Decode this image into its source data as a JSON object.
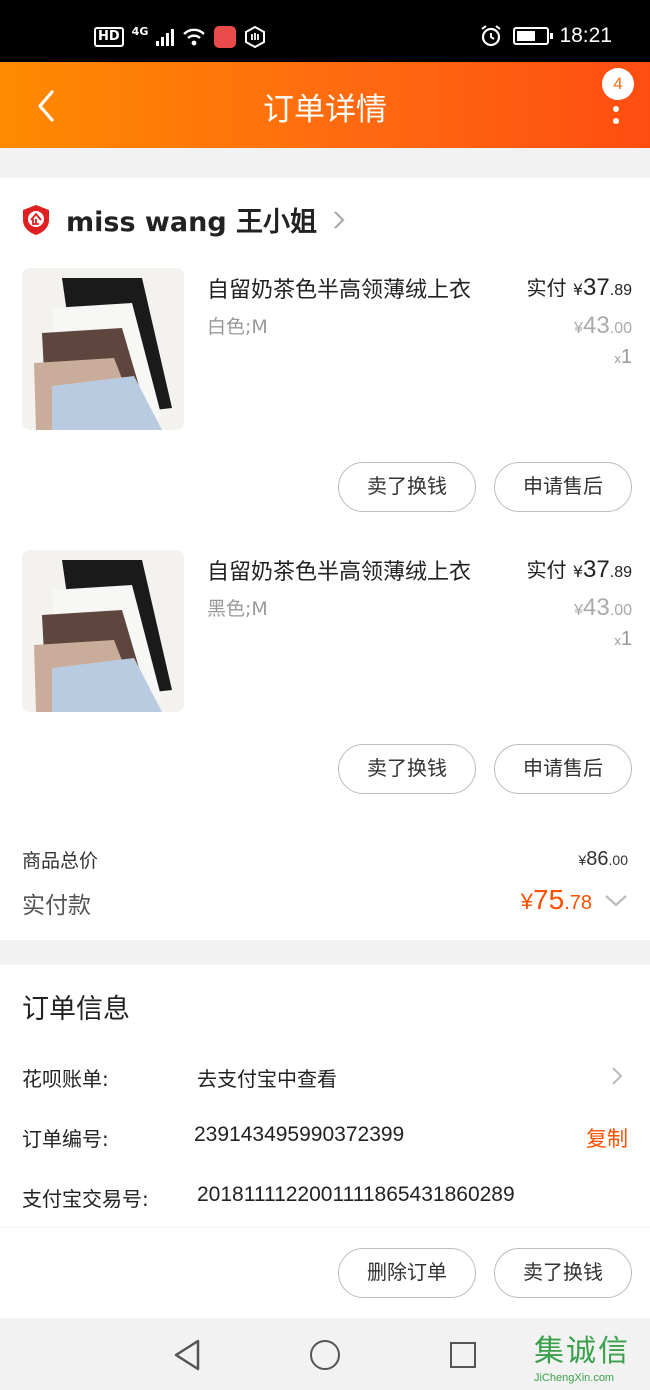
{
  "status_bar": {
    "hd": "HD",
    "network": "4G",
    "time": "18:21"
  },
  "header": {
    "title": "订单详情",
    "badge_count": "4"
  },
  "shop": {
    "name": "miss wang 王小姐"
  },
  "items": [
    {
      "name": "自留奶茶色半高领薄绒上衣",
      "sku": "白色;M",
      "paid_label": "实付",
      "paid_int": "37",
      "paid_dec": ".89",
      "orig_int": "43",
      "orig_dec": ".00",
      "qty": "1",
      "btn_sell": "卖了换钱",
      "btn_after_sale": "申请售后"
    },
    {
      "name": "自留奶茶色半高领薄绒上衣",
      "sku": "黑色;M",
      "paid_label": "实付",
      "paid_int": "37",
      "paid_dec": ".89",
      "orig_int": "43",
      "orig_dec": ".00",
      "qty": "1",
      "btn_sell": "卖了换钱",
      "btn_after_sale": "申请售后"
    }
  ],
  "summary": {
    "goods_total_label": "商品总价",
    "goods_total_int": "86",
    "goods_total_dec": ".00",
    "paid_label": "实付款",
    "paid_int": "75",
    "paid_dec": ".78"
  },
  "currency": "¥",
  "qty_prefix": "x",
  "order_info": {
    "title": "订单信息",
    "huabei_label": "花呗账单:",
    "huabei_value": "去支付宝中查看",
    "order_no_label": "订单编号:",
    "order_no_value": "239143495990372399",
    "copy_label": "复制",
    "alipay_no_label": "支付宝交易号:",
    "alipay_no_value": "2018111122001111865431860289"
  },
  "actions": {
    "delete_order": "删除订单",
    "sell": "卖了换钱"
  },
  "watermark": {
    "title": "集诚信",
    "url": "JiChengXin.com"
  },
  "colors": {
    "accent": "#ff5000",
    "header_start": "#ff8a00",
    "header_end": "#ff4d12"
  }
}
